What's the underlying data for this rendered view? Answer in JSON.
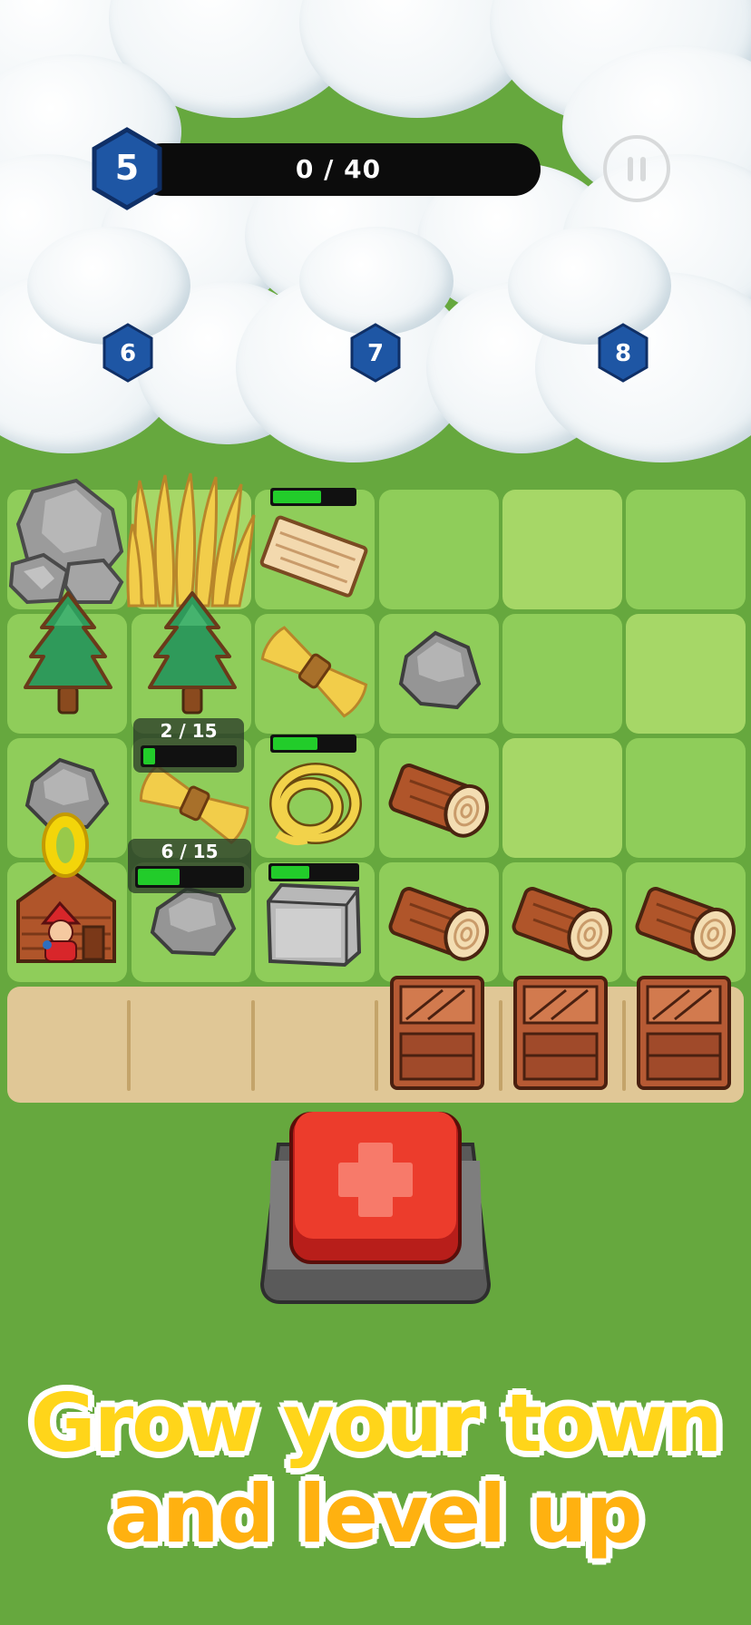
{
  "hud": {
    "level": "5",
    "xp_text": "0 / 40",
    "xp_progress": 0
  },
  "zones": [
    "6",
    "7",
    "8"
  ],
  "tiles": {
    "row1": [
      "rock",
      "wheat",
      "plank",
      "empty",
      "empty",
      "empty"
    ],
    "row2": [
      "pine-tree",
      "pine-tree",
      "hay-bundle",
      "small-rock",
      "empty",
      "empty"
    ],
    "row3": [
      "small-rock",
      "hay-bundle",
      "rope",
      "log",
      "empty",
      "empty"
    ],
    "row4": [
      "cabin",
      "small-rock",
      "stone-block",
      "log",
      "log",
      "log"
    ]
  },
  "progress": {
    "plank": 0.6,
    "rope": 0.55,
    "stone_block": 0.45
  },
  "counters": {
    "hay": {
      "text": "2 / 15",
      "value": 2,
      "max": 15
    },
    "rock": {
      "text": "6 / 15",
      "value": 6,
      "max": 15
    }
  },
  "tray": {
    "slots": [
      "empty",
      "empty",
      "empty",
      "crate",
      "crate",
      "crate"
    ]
  },
  "colors": {
    "level_hex": "#1e56a4",
    "progress_fill": "#22cc2a",
    "button_red": "#e8392a"
  },
  "tagline": {
    "line1": "Grow your town",
    "line2": "and level up"
  }
}
